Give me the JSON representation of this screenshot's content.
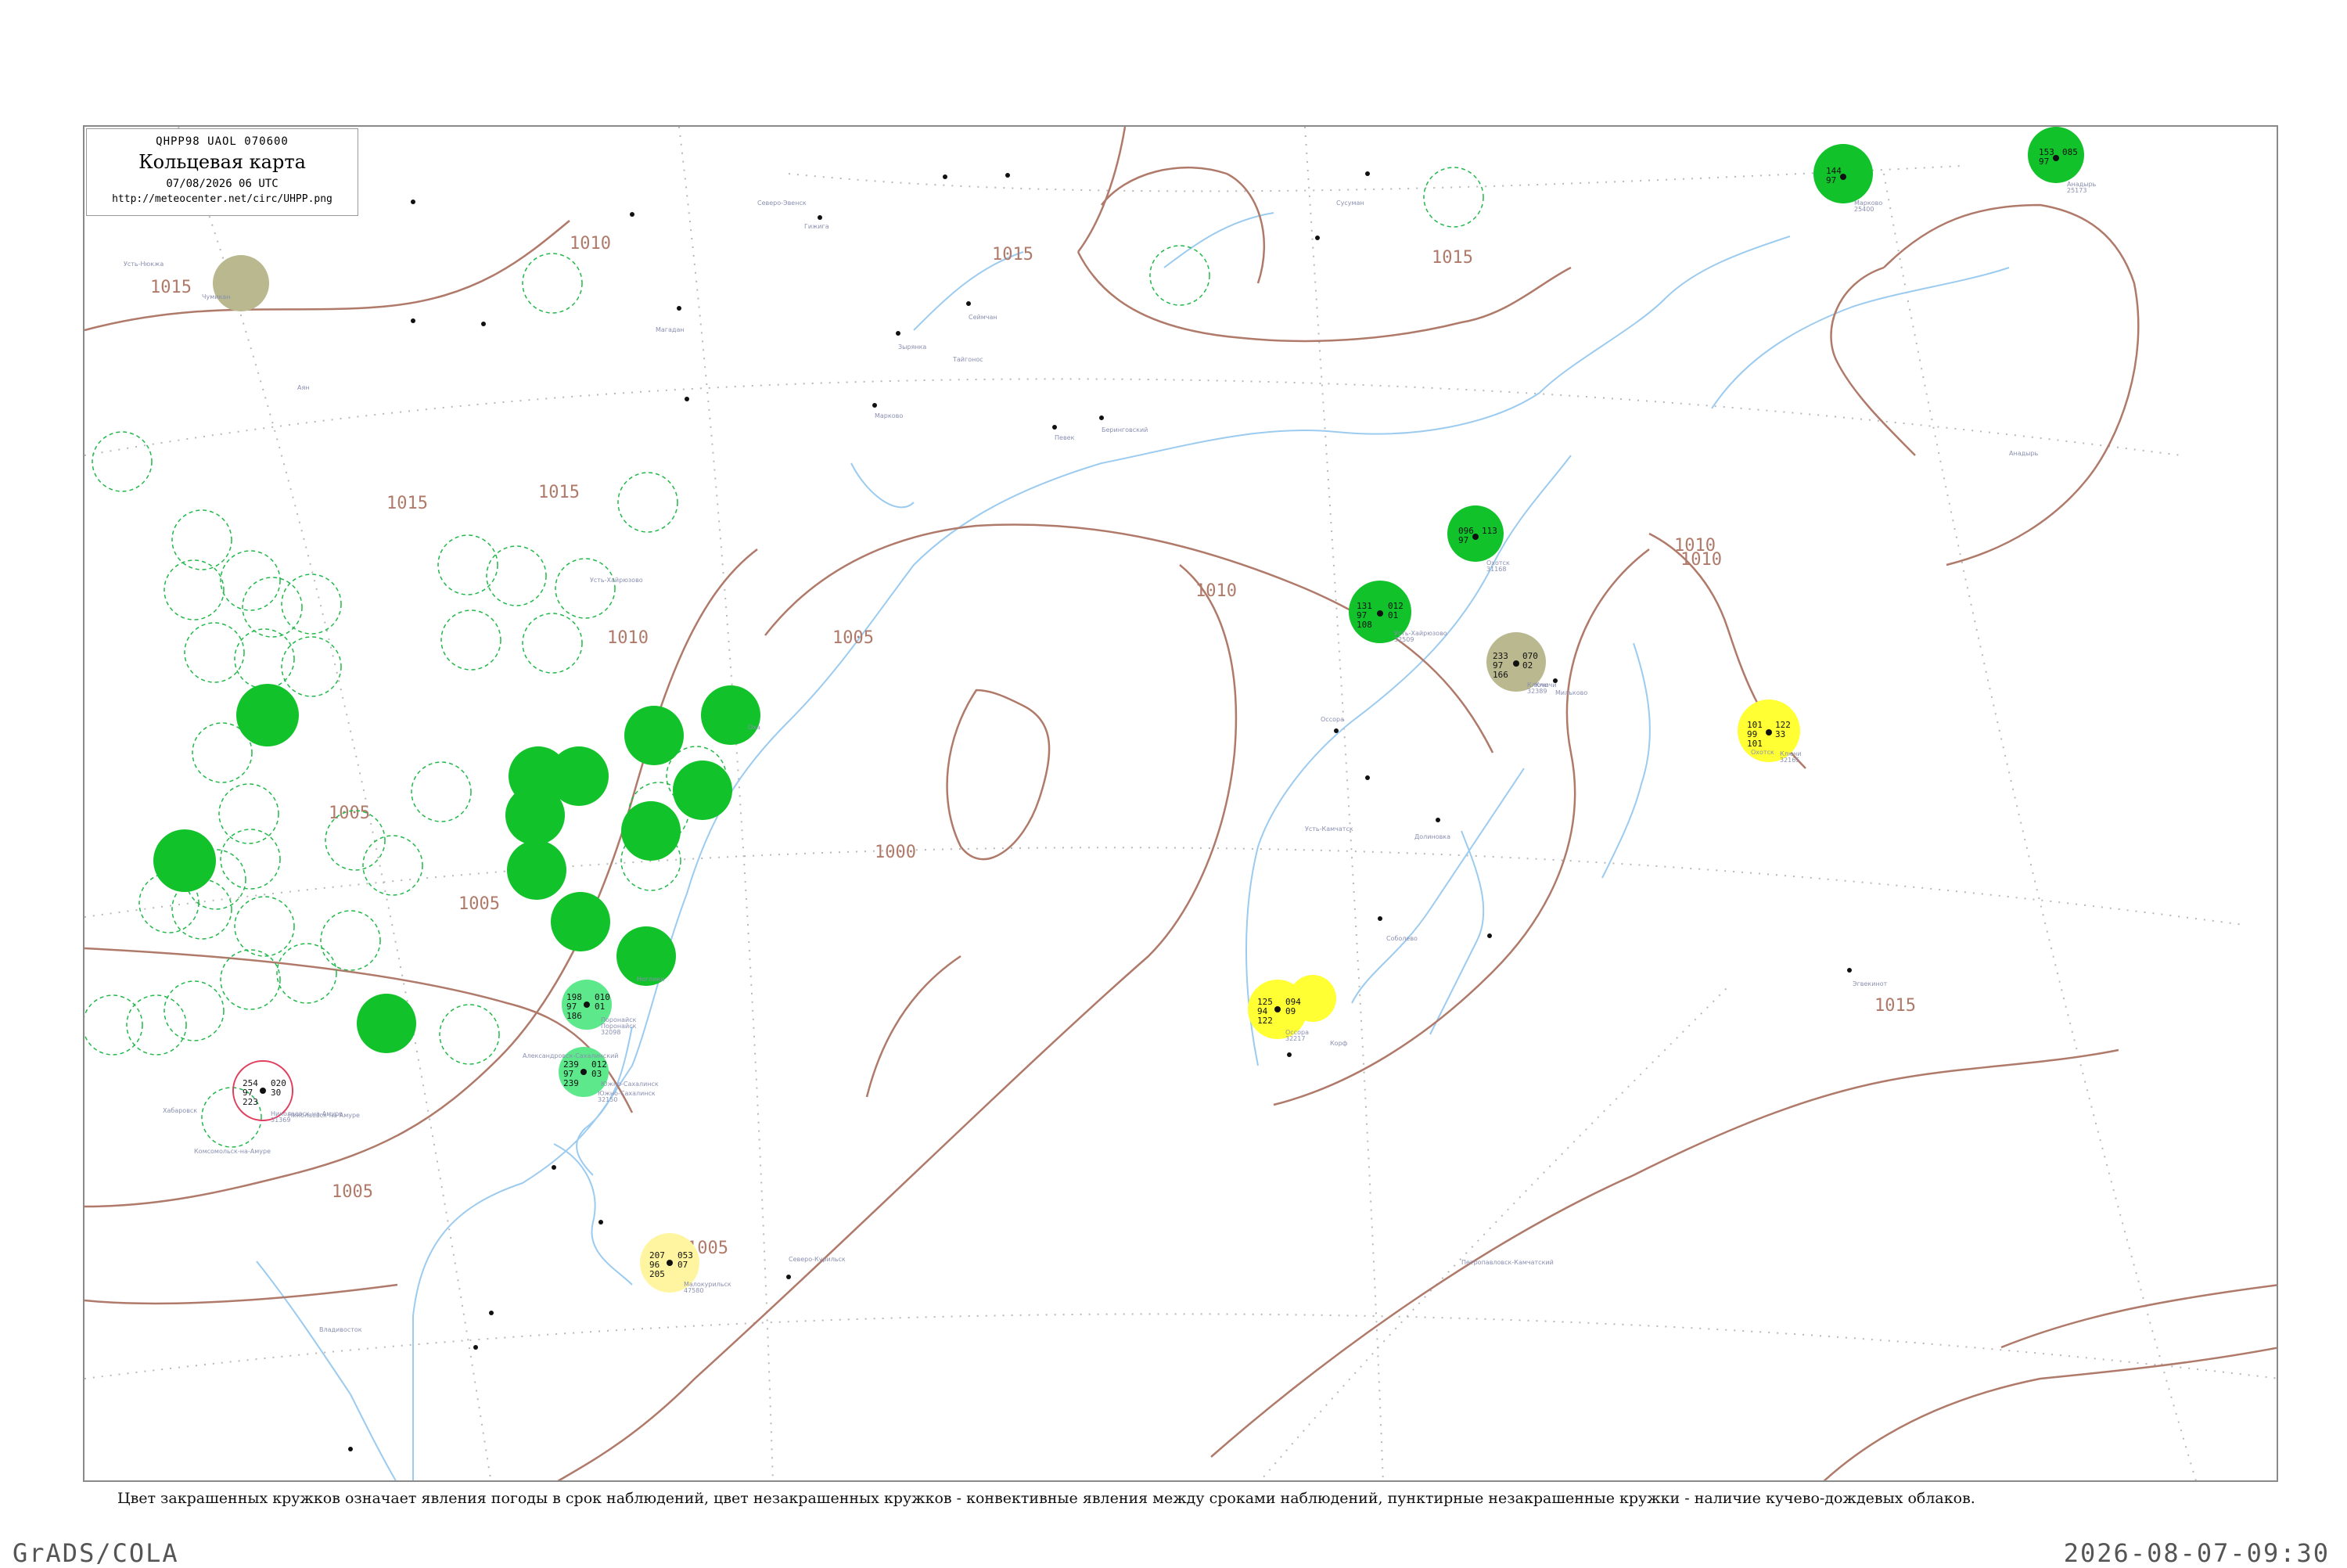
{
  "header": {
    "code_line": "QHPP98  UAOL  070600",
    "title": "Кольцевая карта",
    "date_line": "07/08/2026 06 UTC",
    "url": "http://meteocenter.net/circ/UHPP.png"
  },
  "caption": "Цвет закрашенных кружков означает явления погоды в срок наблюдений, цвет незакрашенных кружков - конвективные явления между сроками наблюдений, пунктирные незакрашенные кружки - наличие кучево-дождевых облаков.",
  "footer": {
    "software": "GrADS/COLA",
    "timestamp": "2026-08-07-09:30"
  },
  "colors": {
    "isobar": "#b07a6a",
    "coast": "#9ccbf0",
    "grid": "#b8b8b8",
    "rain": "#11c22b",
    "rain_light": "#5de88b",
    "thunder_yellow": "#ffff33",
    "fog": "#b9b88f",
    "pale_yellow": "#fff5a0",
    "dashed_cb": "#22b84a",
    "convective_red": "#e04060"
  },
  "isobar_labels": [
    {
      "text": "1015"
    },
    {
      "text": "1015"
    },
    {
      "text": "1015"
    },
    {
      "text": "1015"
    },
    {
      "text": "1010"
    },
    {
      "text": "1010"
    },
    {
      "text": "1010"
    },
    {
      "text": "1010"
    },
    {
      "text": "1005"
    },
    {
      "text": "1005"
    },
    {
      "text": "1005"
    },
    {
      "text": "1005"
    },
    {
      "text": "1005"
    },
    {
      "text": "1000"
    },
    {
      "text": "1015"
    },
    {
      "text": "1015"
    },
    {
      "text": "1010"
    }
  ],
  "stations": [
    {
      "id": "32165",
      "name": "Ключи",
      "pressure": "101",
      "temp": "99",
      "dew": "101",
      "tend": "122",
      "val2": "33",
      "fill": "yellow"
    },
    {
      "id": "32389",
      "name": "Ключи",
      "pressure": "233",
      "temp": "97",
      "dew": "166",
      "tend": "070",
      "val2": "02",
      "fill": "fog"
    },
    {
      "id": "32217",
      "name": "Оссора",
      "pressure": "125",
      "temp": "94",
      "dew": "122",
      "tend": "094",
      "val2": "09",
      "fill": "yellow"
    },
    {
      "id": "32509",
      "name": "Усть-Хайрюзово",
      "pressure": "131",
      "temp": "97",
      "dew": "108",
      "tend": "012",
      "val2": "01",
      "fill": "rain"
    },
    {
      "id": "31168",
      "name": "Охотск",
      "pressure": "096",
      "temp": "97",
      "dew": "",
      "tend": "113",
      "val2": "",
      "fill": "rain"
    },
    {
      "id": "25173",
      "name": "Анадырь",
      "pressure": "153",
      "temp": "97",
      "dew": "",
      "tend": "085",
      "val2": "",
      "fill": "rain"
    },
    {
      "id": "25400",
      "name": "Марково",
      "pressure": "144",
      "temp": "97",
      "dew": "",
      "tend": "",
      "val2": "",
      "fill": "rain"
    },
    {
      "id": "32098",
      "name": "Поронайск",
      "pressure": "198",
      "temp": "97",
      "dew": "186",
      "tend": "010",
      "val2": "01",
      "fill": "rain_light"
    },
    {
      "id": "32150",
      "name": "Южно-Сахалинск",
      "pressure": "239",
      "temp": "97",
      "dew": "239",
      "tend": "012",
      "val2": "03",
      "fill": "rain_light"
    },
    {
      "id": "47580",
      "name": "Малокурильск",
      "pressure": "207",
      "temp": "96",
      "dew": "205",
      "tend": "053",
      "val2": "07",
      "fill": "pale_yellow"
    },
    {
      "id": "31369",
      "name": "Николаевск-на-Амуре",
      "pressure": "254",
      "temp": "97",
      "dew": "223",
      "tend": "020",
      "val2": "30",
      "fill": "convective"
    }
  ],
  "station_names": [
    "Усть-Нюкжа",
    "Чумикан",
    "Аян",
    "Охотск",
    "Магадан",
    "Северо-Курильск",
    "Петропавловск-Камчатский",
    "Усть-Камчатск",
    "Оссора",
    "Эгвекинот",
    "Певек",
    "Анадырь",
    "Беринговский",
    "Марково",
    "Зырянка",
    "Сеймчан",
    "Сусуман",
    "Хабаровск",
    "Комсомольск-на-Амуре",
    "Николаевск-на-Амуре",
    "Поронайск",
    "Южно-Сахалинск",
    "Александровск-Сахалинский",
    "Ноглики",
    "Оха",
    "Владивосток",
    "Корф",
    "Соболево",
    "Долиновка",
    "Мильково",
    "Усть-Хайрюзово",
    "Ключи",
    "Северо-Эвенск",
    "Тайгонос",
    "Гижига"
  ]
}
